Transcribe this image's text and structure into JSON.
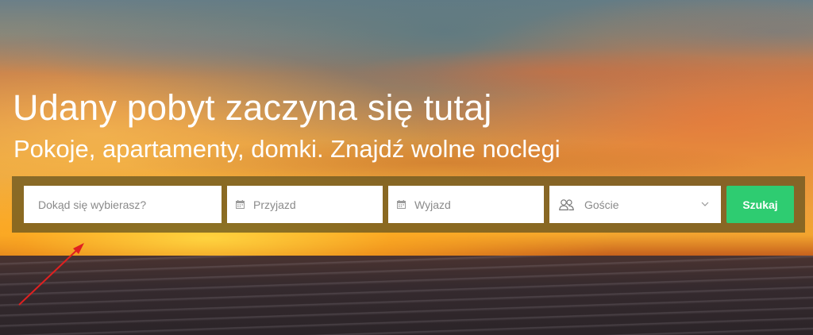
{
  "hero": {
    "headline": "Udany pobyt zaczyna się tutaj",
    "subheadline": "Pokoje, apartamenty, domki. Znajdź wolne noclegi"
  },
  "search": {
    "destination_placeholder": "Dokąd się wybierasz?",
    "checkin_placeholder": "Przyjazd",
    "checkout_placeholder": "Wyjazd",
    "guests_label": "Goście",
    "submit_label": "Szukaj"
  },
  "icons": {
    "checkin": "calendar-icon",
    "checkout": "calendar-icon",
    "guests": "users-icon",
    "guests_dropdown": "chevron-down-icon",
    "annotation": "red-arrow"
  },
  "colors": {
    "search_button": "#2ecc71",
    "search_bar_overlay": "rgba(95, 80, 30, 0.72)",
    "annotation_arrow": "#e02020",
    "text_on_hero": "#ffffff"
  }
}
